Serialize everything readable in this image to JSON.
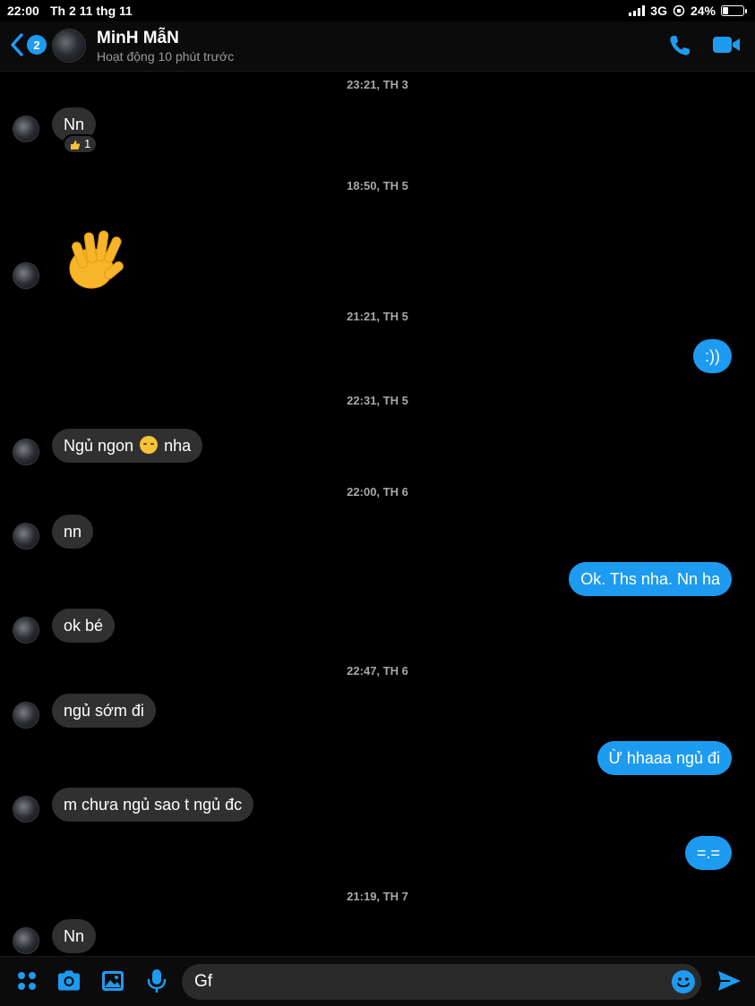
{
  "status_bar": {
    "time": "22:00",
    "date": "Th 2 11 thg 11",
    "network": "3G",
    "battery": "24%",
    "battery_level": 0.24
  },
  "header": {
    "back_badge": "2",
    "contact_name": "MinH MẫN",
    "contact_status": "Hoạt động 10 phút trước"
  },
  "messages": {
    "ts1": "23:21, TH 3",
    "m1": "Nn",
    "m1_reaction_count": "1",
    "ts2": "18:50, TH 5",
    "ts3": "21:21, TH 5",
    "m3": ":))",
    "ts4": "22:31, TH 5",
    "m4_a": "Ngủ ngon",
    "m4_b": "nha",
    "ts5": "22:00, TH 6",
    "m5": "nn",
    "m6": "Ok. Ths nha. Nn ha",
    "m7": "ok bé",
    "ts6": "22:47, TH 6",
    "m8": "ngủ sớm đi",
    "m9": "Ừ hhaaa ngủ đi",
    "m10": "m chưa ngủ sao t ngủ đc",
    "m11": "=.=",
    "ts7": "21:19, TH 7",
    "m12": "Nn"
  },
  "composer": {
    "input_value": "Gf"
  },
  "colors": {
    "accent": "#1d9bf0",
    "incoming_bubble": "#303030",
    "background": "#000000"
  }
}
